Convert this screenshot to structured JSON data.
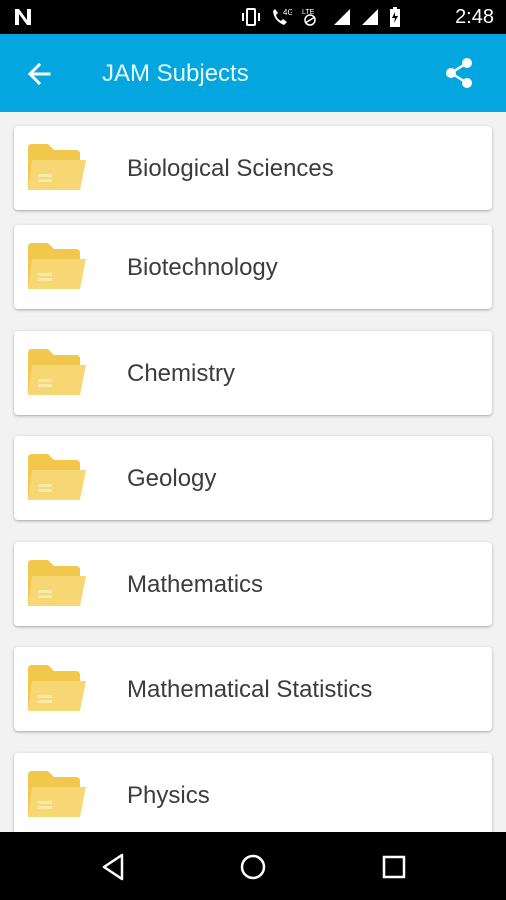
{
  "status_bar": {
    "time": "2:48",
    "notification_icon": "n-icon",
    "icons": [
      "vibrate-icon",
      "wifi-calling-icon",
      "4g-icon",
      "lte-icon",
      "signal-icon",
      "signal-icon",
      "battery-icon"
    ]
  },
  "app_bar": {
    "title": "JAM Subjects",
    "back_icon": "arrow-back-icon",
    "share_icon": "share-icon",
    "background": "#04a6df"
  },
  "subjects": [
    {
      "label": "Biological Sciences"
    },
    {
      "label": "Biotechnology"
    },
    {
      "label": "Chemistry"
    },
    {
      "label": "Geology"
    },
    {
      "label": "Mathematics"
    },
    {
      "label": "Mathematical Statistics"
    },
    {
      "label": "Physics"
    }
  ],
  "folder_color": "#f7d774",
  "nav_bar": {
    "back_icon": "nav-back-icon",
    "home_icon": "nav-home-icon",
    "recents_icon": "nav-recents-icon"
  }
}
